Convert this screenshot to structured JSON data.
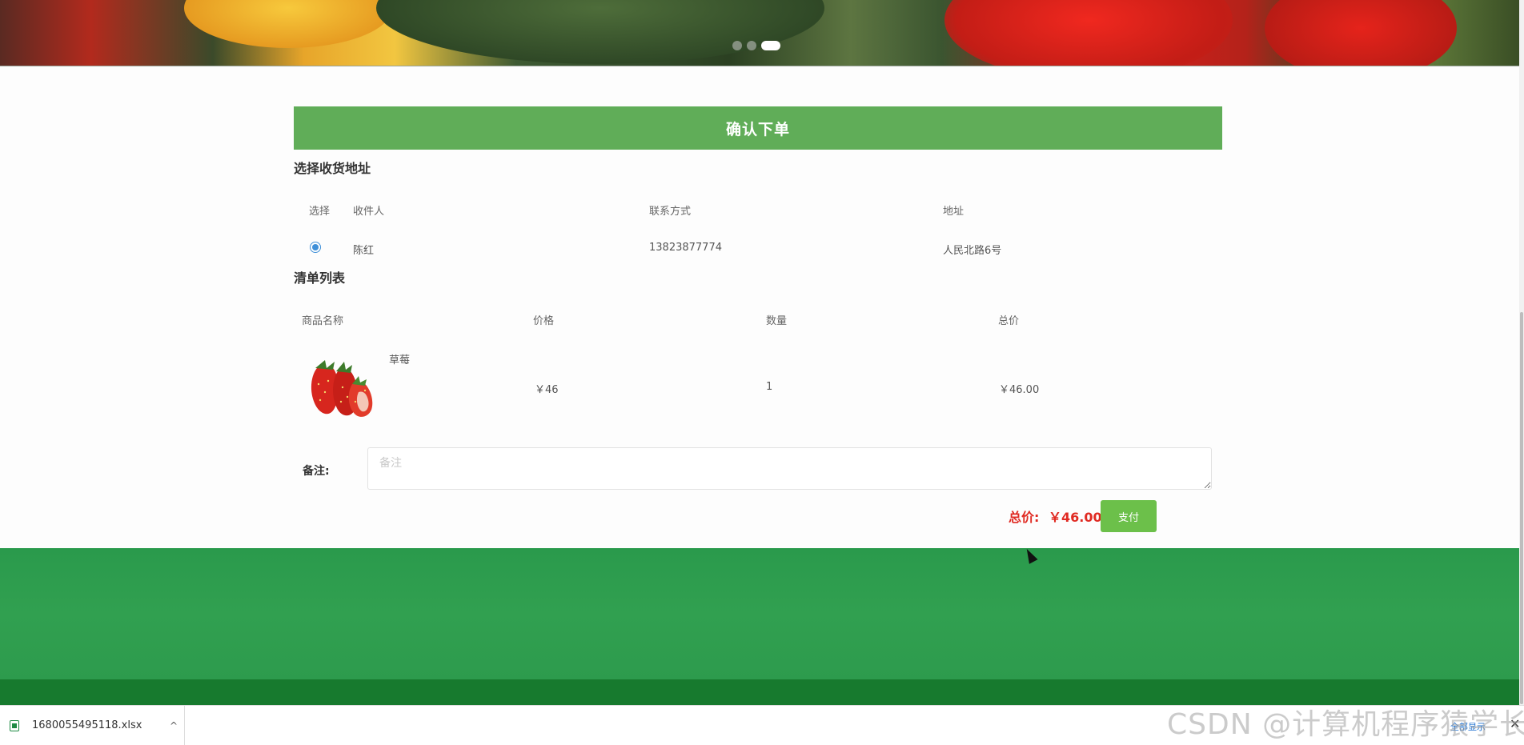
{
  "banner": {
    "slides": 3,
    "active_slide": 3
  },
  "page": {
    "header": "确认下单"
  },
  "address": {
    "title": "选择收货地址",
    "columns": [
      "选择",
      "收件人",
      "联系方式",
      "地址"
    ],
    "rows": [
      {
        "selected": true,
        "name": "陈红",
        "phone": "13823877774",
        "address": "人民北路6号"
      }
    ]
  },
  "order": {
    "title": "清单列表",
    "columns": [
      "商品名称",
      "价格",
      "数量",
      "总价"
    ],
    "items": [
      {
        "name": "草莓",
        "price": "￥46",
        "quantity": "1",
        "total": "￥46.00",
        "image_icon": "strawberry-image"
      }
    ]
  },
  "remark": {
    "label": "备注:",
    "placeholder": "备注",
    "value": ""
  },
  "summary": {
    "total_label": "总价:",
    "total_value": "￥46.00",
    "pay_label": "支付"
  },
  "download_bar": {
    "file_name": "1680055495118.xlsx",
    "show_all": "全部显示"
  },
  "watermark": "CSDN @计算机程序猿学长",
  "colors": {
    "accent_green": "#60ad58",
    "price_red": "#e02a22",
    "footer_green": "#2d9b4d",
    "pay_green": "#6cc04a"
  }
}
